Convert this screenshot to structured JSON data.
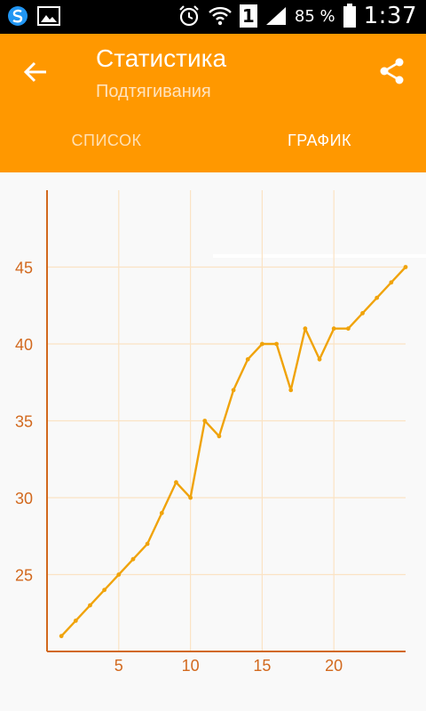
{
  "status_bar": {
    "battery": "85 %",
    "time": "1:37",
    "sim": "1",
    "icons": [
      "sync-icon",
      "gallery-icon",
      "alarm-icon",
      "wifi-icon",
      "sim-icon",
      "signal-icon",
      "battery-icon"
    ]
  },
  "app_bar": {
    "title": "Статистика",
    "subtitle": "Подтягивания",
    "color": "#ff9800",
    "back_icon": "arrow-back-icon",
    "share_icon": "share-icon"
  },
  "tabs": [
    {
      "label": "СПИСОК",
      "selected": false
    },
    {
      "label": "ГРАФИК",
      "selected": true
    }
  ],
  "chart_data": {
    "type": "line",
    "x": [
      1,
      2,
      3,
      4,
      5,
      6,
      7,
      8,
      9,
      10,
      11,
      12,
      13,
      14,
      15,
      16,
      17,
      18,
      19,
      20,
      21,
      22,
      23,
      24,
      25
    ],
    "series": [
      {
        "values": [
          21,
          22,
          23,
          24,
          25,
          26,
          27,
          29,
          31,
          30,
          35,
          34,
          37,
          39,
          40,
          40,
          37,
          41,
          39,
          41,
          41,
          42,
          43,
          44,
          45
        ]
      }
    ],
    "x_ticks": [
      5,
      10,
      15,
      20
    ],
    "y_ticks": [
      25,
      30,
      35,
      40,
      45
    ],
    "xlim": [
      0,
      25
    ],
    "ylim": [
      20,
      50
    ],
    "grid": true,
    "line_color": "#f0a30a",
    "axis_color": "#d2691e"
  }
}
